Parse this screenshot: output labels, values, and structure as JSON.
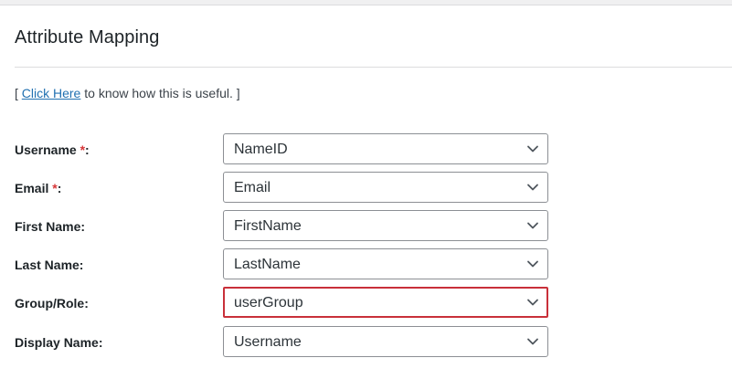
{
  "section": {
    "title": "Attribute Mapping"
  },
  "help": {
    "prefix": "[ ",
    "link_text": "Click Here",
    "suffix": " to know how this is useful. ]"
  },
  "mappings": [
    {
      "label": "Username",
      "required_mark": "*",
      "colon": ":",
      "value": "NameID"
    },
    {
      "label": "Email",
      "required_mark": "*",
      "colon": ":",
      "value": "Email"
    },
    {
      "label": "First Name:",
      "value": "FirstName"
    },
    {
      "label": "Last Name:",
      "value": "LastName"
    },
    {
      "label": "Group/Role:",
      "value": "userGroup"
    },
    {
      "label": "Display Name:",
      "value": "Username"
    }
  ],
  "icons": {
    "dropdown": "chevron-down-icon"
  },
  "colors": {
    "link": "#2271b1",
    "required": "#d63638",
    "focus_border": "#c9303a",
    "border": "#8c8f94"
  }
}
